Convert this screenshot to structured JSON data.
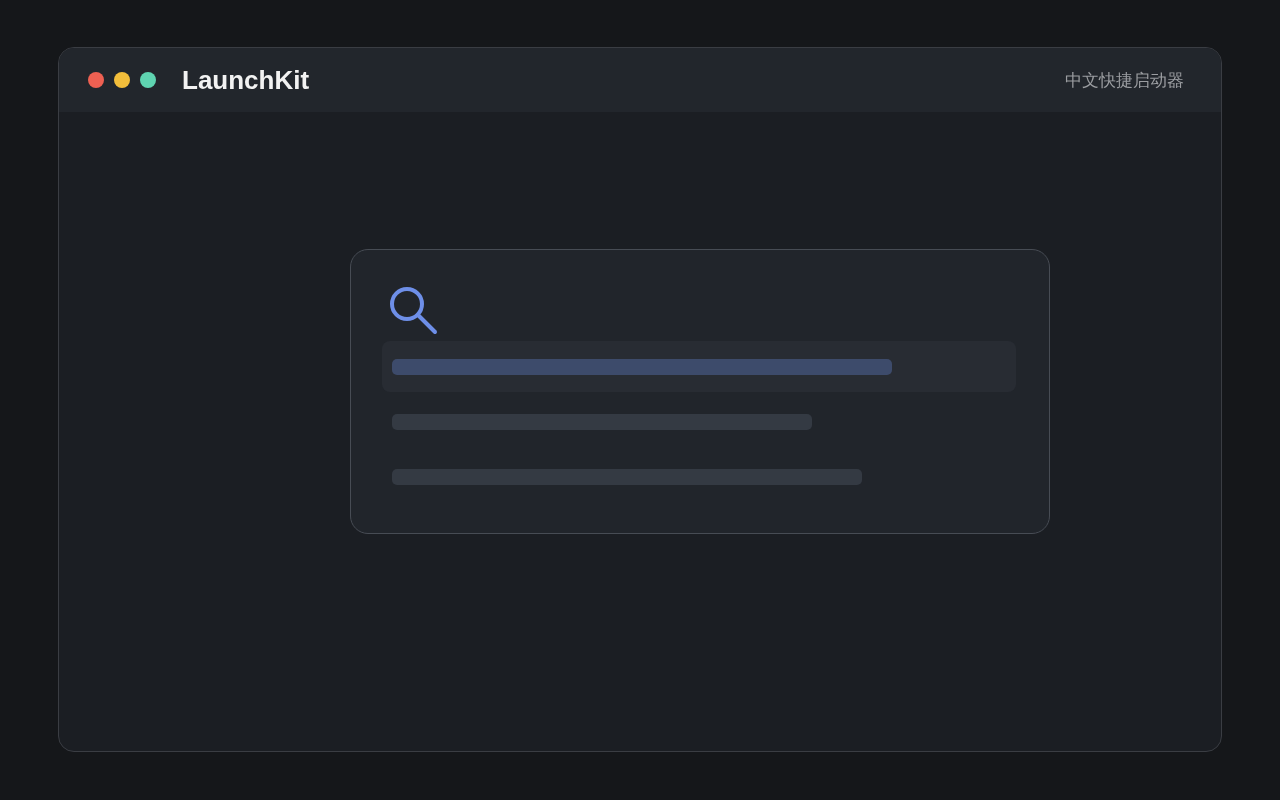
{
  "window": {
    "title": "LaunchKit",
    "subtitle": "中文快捷启动器",
    "controls": [
      {
        "color": "#ee6052"
      },
      {
        "color": "#f3be3b"
      },
      {
        "color": "#5fd4b1"
      }
    ]
  },
  "launcher": {
    "results": [
      {
        "selected": true
      },
      {
        "selected": false
      },
      {
        "selected": false
      }
    ]
  }
}
